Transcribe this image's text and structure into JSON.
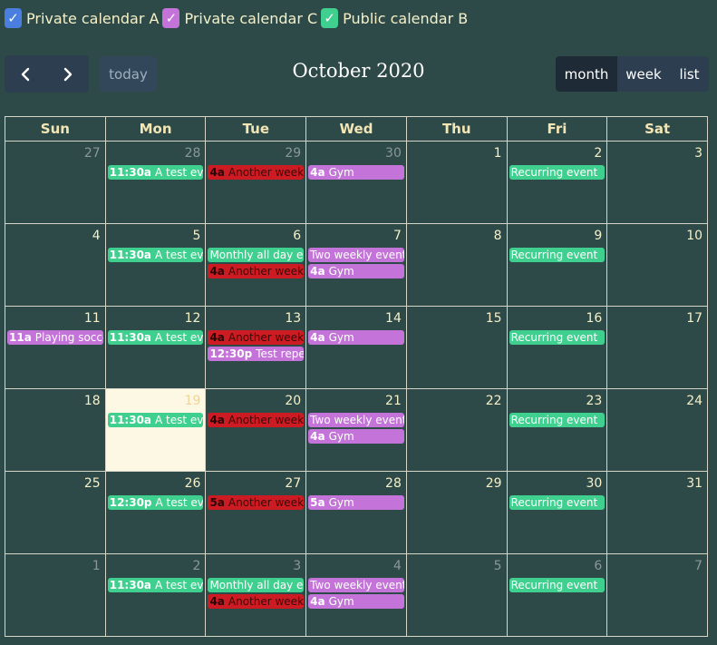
{
  "filters": [
    {
      "label": "Private calendar A",
      "color": "#4a7fe0"
    },
    {
      "label": "Private calendar C",
      "color": "#c473d8"
    },
    {
      "label": "Public calendar B",
      "color": "#3fcf8e"
    }
  ],
  "toolbar": {
    "today": "today",
    "title": "October 2020",
    "views": [
      "month",
      "week",
      "list"
    ],
    "active_view": "month"
  },
  "weekdays": [
    "Sun",
    "Mon",
    "Tue",
    "Wed",
    "Thu",
    "Fri",
    "Sat"
  ],
  "weeks": [
    [
      {
        "n": "27",
        "other": true,
        "events": []
      },
      {
        "n": "28",
        "other": true,
        "events": [
          {
            "time": "11:30a",
            "title": "A test event",
            "color": "green"
          }
        ]
      },
      {
        "n": "29",
        "other": true,
        "events": [
          {
            "time": "4a",
            "title": "Another weekly",
            "color": "red"
          }
        ]
      },
      {
        "n": "30",
        "other": true,
        "events": [
          {
            "time": "4a",
            "title": "Gym",
            "color": "purple"
          }
        ]
      },
      {
        "n": "1",
        "events": []
      },
      {
        "n": "2",
        "events": [
          {
            "time": "",
            "title": "Recurring event",
            "color": "green"
          }
        ]
      },
      {
        "n": "3",
        "events": []
      }
    ],
    [
      {
        "n": "4",
        "events": []
      },
      {
        "n": "5",
        "events": [
          {
            "time": "11:30a",
            "title": "A test event",
            "color": "green"
          }
        ]
      },
      {
        "n": "6",
        "events": [
          {
            "time": "",
            "title": "Monthly all day event",
            "color": "green"
          },
          {
            "time": "4a",
            "title": "Another weekly",
            "color": "red"
          }
        ]
      },
      {
        "n": "7",
        "events": [
          {
            "time": "",
            "title": "Two weekly event",
            "color": "purple"
          },
          {
            "time": "4a",
            "title": "Gym",
            "color": "purple"
          }
        ]
      },
      {
        "n": "8",
        "events": []
      },
      {
        "n": "9",
        "events": [
          {
            "time": "",
            "title": "Recurring event",
            "color": "green"
          }
        ]
      },
      {
        "n": "10",
        "events": []
      }
    ],
    [
      {
        "n": "11",
        "events": [
          {
            "time": "11a",
            "title": "Playing soccer",
            "color": "purple"
          }
        ]
      },
      {
        "n": "12",
        "events": [
          {
            "time": "11:30a",
            "title": "A test event",
            "color": "green"
          }
        ]
      },
      {
        "n": "13",
        "events": [
          {
            "time": "4a",
            "title": "Another weekly",
            "color": "red"
          },
          {
            "time": "12:30p",
            "title": "Test repeat",
            "color": "purple"
          }
        ]
      },
      {
        "n": "14",
        "events": [
          {
            "time": "4a",
            "title": "Gym",
            "color": "purple"
          }
        ]
      },
      {
        "n": "15",
        "events": []
      },
      {
        "n": "16",
        "events": [
          {
            "time": "",
            "title": "Recurring event",
            "color": "green"
          }
        ]
      },
      {
        "n": "17",
        "events": []
      }
    ],
    [
      {
        "n": "18",
        "events": []
      },
      {
        "n": "19",
        "today": true,
        "events": [
          {
            "time": "11:30a",
            "title": "A test event",
            "color": "green"
          }
        ]
      },
      {
        "n": "20",
        "events": [
          {
            "time": "4a",
            "title": "Another weekly",
            "color": "red"
          }
        ]
      },
      {
        "n": "21",
        "events": [
          {
            "time": "",
            "title": "Two weekly event",
            "color": "purple"
          },
          {
            "time": "4a",
            "title": "Gym",
            "color": "purple"
          }
        ]
      },
      {
        "n": "22",
        "events": []
      },
      {
        "n": "23",
        "events": [
          {
            "time": "",
            "title": "Recurring event",
            "color": "green"
          }
        ]
      },
      {
        "n": "24",
        "events": []
      }
    ],
    [
      {
        "n": "25",
        "events": []
      },
      {
        "n": "26",
        "events": [
          {
            "time": "12:30p",
            "title": "A test event",
            "color": "green"
          }
        ]
      },
      {
        "n": "27",
        "events": [
          {
            "time": "5a",
            "title": "Another weekly",
            "color": "red"
          }
        ]
      },
      {
        "n": "28",
        "events": [
          {
            "time": "5a",
            "title": "Gym",
            "color": "purple"
          }
        ]
      },
      {
        "n": "29",
        "events": []
      },
      {
        "n": "30",
        "events": [
          {
            "time": "",
            "title": "Recurring event",
            "color": "green"
          }
        ]
      },
      {
        "n": "31",
        "events": []
      }
    ],
    [
      {
        "n": "1",
        "other": true,
        "events": []
      },
      {
        "n": "2",
        "other": true,
        "events": [
          {
            "time": "11:30a",
            "title": "A test event",
            "color": "green"
          }
        ]
      },
      {
        "n": "3",
        "other": true,
        "events": [
          {
            "time": "",
            "title": "Monthly all day event",
            "color": "green"
          },
          {
            "time": "4a",
            "title": "Another weekly",
            "color": "red"
          }
        ]
      },
      {
        "n": "4",
        "other": true,
        "events": [
          {
            "time": "",
            "title": "Two weekly event",
            "color": "purple"
          },
          {
            "time": "4a",
            "title": "Gym",
            "color": "purple"
          }
        ]
      },
      {
        "n": "5",
        "other": true,
        "events": []
      },
      {
        "n": "6",
        "other": true,
        "events": [
          {
            "time": "",
            "title": "Recurring event",
            "color": "green"
          }
        ]
      },
      {
        "n": "7",
        "other": true,
        "events": []
      }
    ]
  ]
}
